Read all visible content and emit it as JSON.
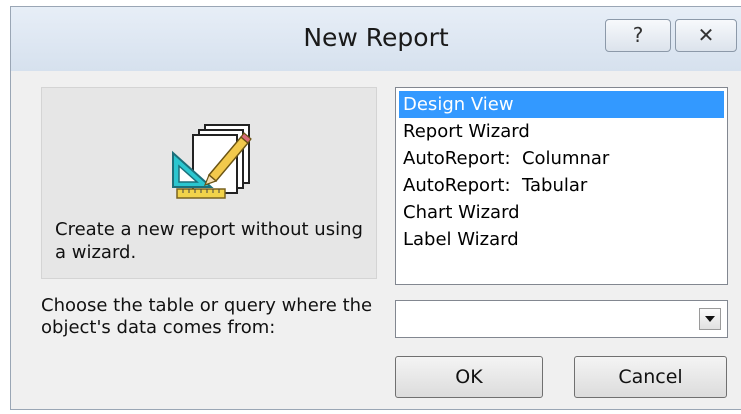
{
  "dialog": {
    "title": "New Report",
    "help_button": "?",
    "close_button": "✕"
  },
  "preview": {
    "icon": "report-design-icon",
    "description": "Create a new report without using a wizard."
  },
  "report_types": {
    "selected": "Design View",
    "items": [
      "Design View",
      "Report Wizard",
      "AutoReport:  Columnar",
      "AutoReport:  Tabular",
      "Chart Wizard",
      "Label Wizard"
    ]
  },
  "source": {
    "label": "Choose the table or query where the object's data comes from:",
    "value": ""
  },
  "buttons": {
    "ok": "OK",
    "cancel": "Cancel"
  },
  "colors": {
    "selection": "#3399ff",
    "dialog_bg": "#f0f0f0"
  }
}
